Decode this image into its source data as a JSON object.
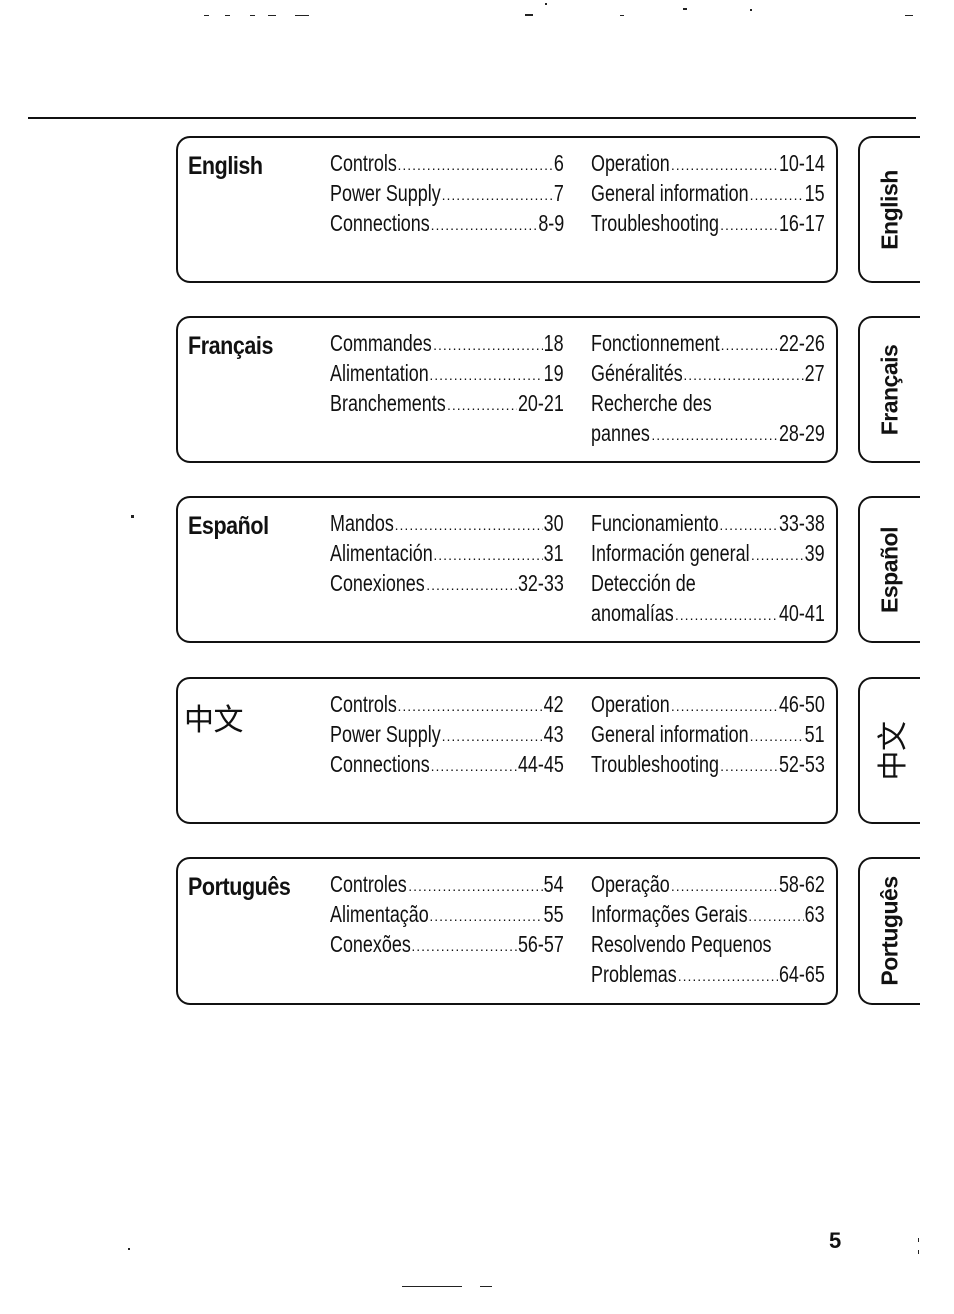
{
  "sections": [
    {
      "title": "English",
      "tab_label": "English",
      "col1": [
        {
          "label": "Controls",
          "page": "6"
        },
        {
          "label": "Power Supply",
          "page": "7"
        },
        {
          "label": "Connections",
          "page": "8-9"
        }
      ],
      "col2": [
        {
          "label": "Operation",
          "page": "10-14"
        },
        {
          "label": "General information",
          "page": "15"
        },
        {
          "label": "Troubleshooting",
          "page": "16-17"
        }
      ]
    },
    {
      "title": "Français",
      "tab_label": "Français",
      "col1": [
        {
          "label": "Commandes",
          "page": "18"
        },
        {
          "label": "Alimentation",
          "page": "19"
        },
        {
          "label": "Branchements",
          "page": "20-21"
        }
      ],
      "col2": [
        {
          "label": "Fonctionnement",
          "page": "22-26"
        },
        {
          "label": "Généralités",
          "page": "27"
        },
        {
          "label": "Recherche des",
          "page": ""
        },
        {
          "label": "pannes",
          "page": "28-29"
        }
      ]
    },
    {
      "title": "Español",
      "tab_label": "Español",
      "col1": [
        {
          "label": "Mandos",
          "page": "30"
        },
        {
          "label": "Alimentación",
          "page": "31"
        },
        {
          "label": "Conexiones",
          "page": "32-33"
        }
      ],
      "col2": [
        {
          "label": "Funcionamiento",
          "page": "33-38"
        },
        {
          "label": "Información general",
          "page": "39"
        },
        {
          "label": "Detección de",
          "page": ""
        },
        {
          "label": "anomalías",
          "page": "40-41"
        }
      ]
    },
    {
      "title": "中文",
      "tab_label": "中文",
      "col1": [
        {
          "label": "Controls",
          "page": "42"
        },
        {
          "label": "Power Supply",
          "page": "43"
        },
        {
          "label": "Connections",
          "page": "44-45"
        }
      ],
      "col2": [
        {
          "label": "Operation",
          "page": "46-50"
        },
        {
          "label": "General information",
          "page": "51"
        },
        {
          "label": "Troubleshooting",
          "page": "52-53"
        }
      ]
    },
    {
      "title": "Português",
      "tab_label": "Português",
      "col1": [
        {
          "label": "Controles",
          "page": "54"
        },
        {
          "label": "Alimentação",
          "page": "55"
        },
        {
          "label": "Conexões",
          "page": "56-57"
        }
      ],
      "col2": [
        {
          "label": "Operação",
          "page": "58-62"
        },
        {
          "label": "Informações Gerais",
          "page": "63"
        },
        {
          "label": "Resolvendo Pequenos",
          "page": ""
        },
        {
          "label": "Problemas",
          "page": "64-65"
        }
      ]
    }
  ],
  "page_number": "5"
}
